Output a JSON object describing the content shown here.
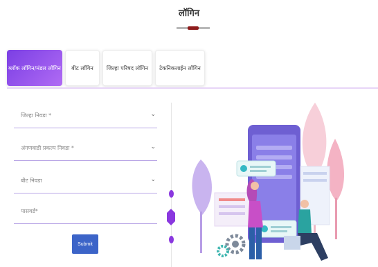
{
  "page": {
    "title": "लॉगिन"
  },
  "tabs": [
    {
      "label": "ब्लॉक लॉगिन/मंडल लॉगिन",
      "active": true
    },
    {
      "label": "बीट लॉगिन",
      "active": false
    },
    {
      "label": "जिल्हा परिषद लॉगिन",
      "active": false
    },
    {
      "label": "टेकनिकलाईन लॉगिन",
      "active": false
    }
  ],
  "form": {
    "district": {
      "label": "जिल्हा निवडा *",
      "icon": "chevron-down-icon"
    },
    "project": {
      "label": "अंगणवाडी प्रकल्प निवडा *",
      "icon": "chevron-down-icon"
    },
    "beat": {
      "label": "बीट निवडा",
      "icon": "chevron-down-icon"
    },
    "password": {
      "label": "पासवर्ड*"
    },
    "submit_label": "Submit"
  },
  "colors": {
    "accent": "#8a38df",
    "tab_active_start": "#7b3fe4",
    "tab_active_end": "#b06bf4",
    "submit": "#3c64c8",
    "title_mark": "#8e1b1b"
  }
}
